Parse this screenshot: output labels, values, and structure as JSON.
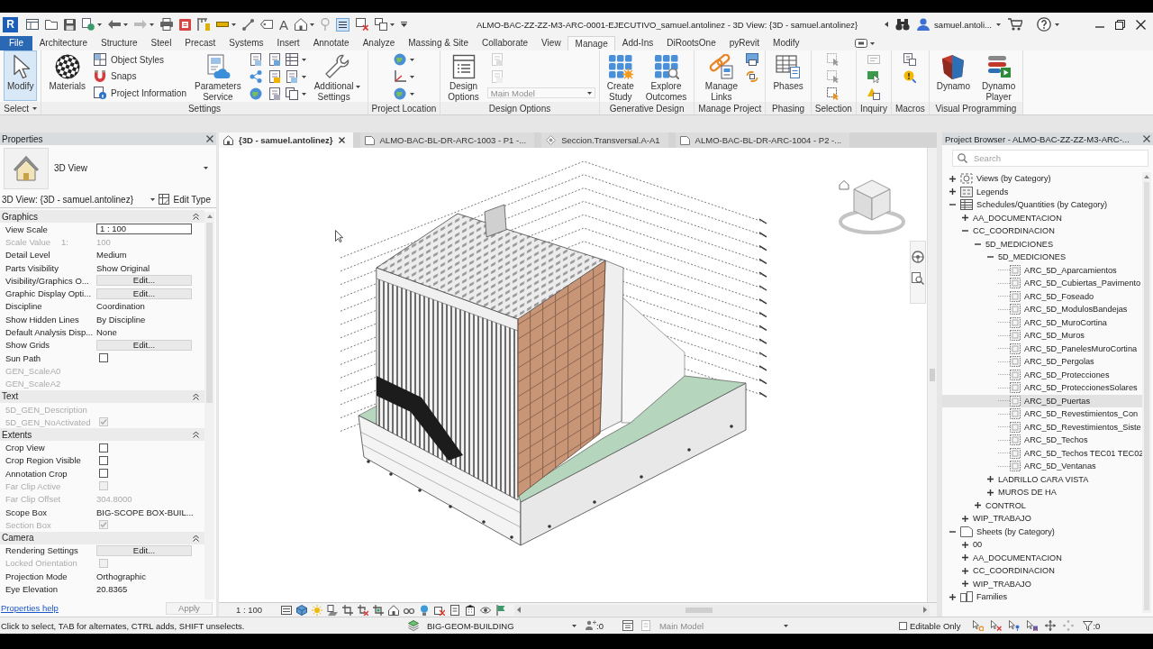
{
  "title_bar": {
    "logo": "R",
    "text_tool": "A",
    "title": "ALMO-BAC-ZZ-ZZ-M3-ARC-0001-EJECUTIVO_samuel.antolinez - 3D View: {3D - samuel.antolinez}",
    "user": "samuel.antoli..."
  },
  "menu_tabs": [
    {
      "label": "File",
      "kind": "file",
      "selected": false
    },
    {
      "label": "Architecture",
      "kind": "tab",
      "selected": false
    },
    {
      "label": "Structure",
      "kind": "tab",
      "selected": false
    },
    {
      "label": "Steel",
      "kind": "tab",
      "selected": false
    },
    {
      "label": "Precast",
      "kind": "tab",
      "selected": false
    },
    {
      "label": "Systems",
      "kind": "tab",
      "selected": false
    },
    {
      "label": "Insert",
      "kind": "tab",
      "selected": false
    },
    {
      "label": "Annotate",
      "kind": "tab",
      "selected": false
    },
    {
      "label": "Analyze",
      "kind": "tab",
      "selected": false
    },
    {
      "label": "Massing & Site",
      "kind": "tab",
      "selected": false
    },
    {
      "label": "Collaborate",
      "kind": "tab",
      "selected": false
    },
    {
      "label": "View",
      "kind": "tab",
      "selected": false
    },
    {
      "label": "Manage",
      "kind": "tab",
      "selected": true
    },
    {
      "label": "Add-Ins",
      "kind": "tab",
      "selected": false
    },
    {
      "label": "DiRootsOne",
      "kind": "tab",
      "selected": false
    },
    {
      "label": "pyRevit",
      "kind": "tab",
      "selected": false
    },
    {
      "label": "Modify",
      "kind": "tab",
      "selected": false
    }
  ],
  "ribbon": {
    "panels": [
      {
        "title": "Select",
        "menu": true,
        "tools": [
          {
            "kind": "large",
            "label": "Modify",
            "active": true,
            "menu": false
          }
        ]
      },
      {
        "title": "Settings",
        "menu": false,
        "tools": [
          {
            "kind": "large",
            "label": "Materials",
            "active": false,
            "menu": false
          },
          {
            "kind": "small_stack",
            "labels": [
              "Object Styles",
              "Snaps",
              "Project Information"
            ]
          },
          {
            "kind": "large",
            "label": "Parameters Service",
            "active": false,
            "menu": false
          },
          {
            "kind": "icon_grid"
          },
          {
            "kind": "icon_menus"
          },
          {
            "kind": "large",
            "label": "Additional Settings",
            "active": false,
            "menu": true
          }
        ]
      },
      {
        "title": "Project Location",
        "menu": false,
        "tools": [
          {
            "kind": "icon_menus"
          }
        ]
      },
      {
        "title": "Design Options",
        "menu": false,
        "tools": [
          {
            "kind": "large",
            "label": "Design Options",
            "active": false,
            "menu": false
          },
          {
            "kind": "option_set",
            "value": "Main Model",
            "disabled": true
          }
        ]
      },
      {
        "title": "Generative Design",
        "menu": false,
        "tools": [
          {
            "kind": "large",
            "label": "Create Study",
            "active": false,
            "menu": false
          },
          {
            "kind": "large",
            "label": "Explore Outcomes",
            "active": false,
            "menu": false
          }
        ]
      },
      {
        "title": "Manage Project",
        "menu": false,
        "tools": [
          {
            "kind": "large",
            "label": "Manage Links",
            "active": false,
            "menu": false
          },
          {
            "kind": "icon_column"
          }
        ]
      },
      {
        "title": "Phasing",
        "menu": false,
        "tools": [
          {
            "kind": "large",
            "label": "Phases",
            "active": false,
            "menu": false
          }
        ]
      },
      {
        "title": "Selection",
        "menu": false,
        "tools": [
          {
            "kind": "icon_column"
          }
        ]
      },
      {
        "title": "Inquiry",
        "menu": false,
        "tools": [
          {
            "kind": "icon_column"
          }
        ]
      },
      {
        "title": "Macros",
        "menu": false,
        "tools": [
          {
            "kind": "icon_column"
          }
        ]
      },
      {
        "title": "Visual Programming",
        "menu": false,
        "tools": [
          {
            "kind": "large",
            "label": "Dynamo",
            "active": false,
            "menu": false
          },
          {
            "kind": "large",
            "label": "Dynamo Player",
            "active": false,
            "menu": false
          }
        ]
      }
    ]
  },
  "properties": {
    "title": "Properties",
    "type_name": "3D View",
    "instance": "3D View: {3D - samuel.antolinez}",
    "edit_type": "Edit Type",
    "groups": [
      {
        "title": "Graphics",
        "expanded": true,
        "rows": [
          {
            "name": "View Scale",
            "kind": "field",
            "value": "1 : 100",
            "disabled": false
          },
          {
            "name": "Scale Value",
            "unit": "1:",
            "kind": "text",
            "value": "100",
            "disabled": true
          },
          {
            "name": "Detail Level",
            "kind": "text",
            "value": "Medium",
            "disabled": false
          },
          {
            "name": "Parts Visibility",
            "kind": "text",
            "value": "Show Original",
            "disabled": false
          },
          {
            "name": "Visibility/Graphics O...",
            "kind": "button",
            "value": "Edit...",
            "disabled": false
          },
          {
            "name": "Graphic Display Opti...",
            "kind": "button",
            "value": "Edit...",
            "disabled": false
          },
          {
            "name": "Discipline",
            "kind": "text",
            "value": "Coordination",
            "disabled": false
          },
          {
            "name": "Show Hidden Lines",
            "kind": "text",
            "value": "By Discipline",
            "disabled": false
          },
          {
            "name": "Default Analysis Disp...",
            "kind": "text",
            "value": "None",
            "disabled": false
          },
          {
            "name": "Show Grids",
            "kind": "button",
            "value": "Edit...",
            "disabled": false
          },
          {
            "name": "Sun Path",
            "kind": "checkbox",
            "checked": false,
            "disabled": false
          },
          {
            "name": "GEN_ScaleA0",
            "kind": "text",
            "disabled": true
          },
          {
            "name": "GEN_ScaleA2",
            "kind": "text",
            "disabled": true
          }
        ]
      },
      {
        "title": "Text",
        "expanded": true,
        "rows": [
          {
            "name": "5D_GEN_Description",
            "kind": "text",
            "disabled": true
          },
          {
            "name": "5D_GEN_NoActivated",
            "kind": "checkbox",
            "checked": true,
            "disabled": true
          }
        ]
      },
      {
        "title": "Extents",
        "expanded": true,
        "rows": [
          {
            "name": "Crop View",
            "kind": "checkbox",
            "checked": false,
            "disabled": false
          },
          {
            "name": "Crop Region Visible",
            "kind": "checkbox",
            "checked": false,
            "disabled": false
          },
          {
            "name": "Annotation Crop",
            "kind": "checkbox",
            "checked": false,
            "disabled": false
          },
          {
            "name": "Far Clip Active",
            "kind": "checkbox",
            "checked": false,
            "disabled": true
          },
          {
            "name": "Far Clip Offset",
            "kind": "text",
            "value": "304.8000",
            "disabled": true
          },
          {
            "name": "Scope Box",
            "kind": "text",
            "value": "BIG-SCOPE BOX-BUIL...",
            "disabled": false
          },
          {
            "name": "Section Box",
            "kind": "checkbox",
            "checked": true,
            "disabled": true
          }
        ]
      },
      {
        "title": "Camera",
        "expanded": true,
        "rows": [
          {
            "name": "Rendering Settings",
            "kind": "button",
            "value": "Edit...",
            "disabled": false
          },
          {
            "name": "Locked Orientation",
            "kind": "checkbox",
            "checked": false,
            "disabled": true
          },
          {
            "name": "Projection Mode",
            "kind": "text",
            "value": "Orthographic",
            "disabled": false
          },
          {
            "name": "Eye Elevation",
            "kind": "text",
            "value": "20.8365",
            "disabled": false
          }
        ]
      }
    ],
    "help_link": "Properties help",
    "apply": {
      "label": "Apply",
      "disabled": true
    }
  },
  "view_tabs": [
    {
      "label": "{3D - samuel.antolinez}",
      "kind": "model",
      "selected": true
    },
    {
      "label": "ALMO-BAC-BL-DR-ARC-1003 - P1 -...",
      "kind": "sheet",
      "selected": false
    },
    {
      "label": "Seccion.Transversal.A-A1",
      "kind": "section",
      "selected": false
    },
    {
      "label": "ALMO-BAC-BL-DR-ARC-1004 - P2 -...",
      "kind": "sheet",
      "selected": false
    }
  ],
  "view_control_bar": {
    "scale": "1 : 100"
  },
  "project_browser": {
    "title": "Project Browser - ALMO-BAC-ZZ-ZZ-M3-ARC-...",
    "search": {
      "placeholder": "Search"
    },
    "tree": [
      {
        "kind": "category",
        "label": "Views (by Category)",
        "expanded": false,
        "selected": false
      },
      {
        "kind": "category",
        "label": "Legends",
        "expanded": false,
        "selected": false
      },
      {
        "kind": "category",
        "label": "Schedules/Quantities (by Category)",
        "expanded": true,
        "selected": false,
        "children": [
          {
            "kind": "folder",
            "label": "AA_DOCUMENTACION",
            "expanded": false,
            "selected": false
          },
          {
            "kind": "folder",
            "label": "CC_COORDINACION",
            "expanded": true,
            "selected": false,
            "children": [
              {
                "kind": "folder",
                "label": "5D_MEDICIONES",
                "expanded": true,
                "selected": false,
                "children": [
                  {
                    "kind": "folder",
                    "label": "5D_MEDICIONES",
                    "expanded": true,
                    "selected": false,
                    "children": [
                      {
                        "kind": "schedule",
                        "label": "ARC_5D_Aparcamientos",
                        "selected": false
                      },
                      {
                        "kind": "schedule",
                        "label": "ARC_5D_Cubiertas_Pavimento",
                        "selected": false
                      },
                      {
                        "kind": "schedule",
                        "label": "ARC_5D_Foseado",
                        "selected": false
                      },
                      {
                        "kind": "schedule",
                        "label": "ARC_5D_ModulosBandejas",
                        "selected": false
                      },
                      {
                        "kind": "schedule",
                        "label": "ARC_5D_MuroCortina",
                        "selected": false
                      },
                      {
                        "kind": "schedule",
                        "label": "ARC_5D_Muros",
                        "selected": false
                      },
                      {
                        "kind": "schedule",
                        "label": "ARC_5D_PanelesMuroCortina",
                        "selected": false
                      },
                      {
                        "kind": "schedule",
                        "label": "ARC_5D_Pergolas",
                        "selected": false
                      },
                      {
                        "kind": "schedule",
                        "label": "ARC_5D_Protecciones",
                        "selected": false
                      },
                      {
                        "kind": "schedule",
                        "label": "ARC_5D_ProteccionesSolares",
                        "selected": false
                      },
                      {
                        "kind": "schedule",
                        "label": "ARC_5D_Puertas",
                        "selected": true
                      },
                      {
                        "kind": "schedule",
                        "label": "ARC_5D_Revestimientos_Con",
                        "selected": false
                      },
                      {
                        "kind": "schedule",
                        "label": "ARC_5D_Revestimientos_Siste",
                        "selected": false
                      },
                      {
                        "kind": "schedule",
                        "label": "ARC_5D_Techos",
                        "selected": false
                      },
                      {
                        "kind": "schedule",
                        "label": "ARC_5D_Techos TEC01 TEC02",
                        "selected": false
                      },
                      {
                        "kind": "schedule",
                        "label": "ARC_5D_Ventanas",
                        "selected": false
                      }
                    ]
                  },
                  {
                    "kind": "folder",
                    "label": "LADRILLO CARA VISTA",
                    "expanded": false,
                    "selected": false
                  },
                  {
                    "kind": "folder",
                    "label": "MUROS DE HA",
                    "expanded": false,
                    "selected": false
                  }
                ]
              },
              {
                "kind": "folder",
                "label": "CONTROL",
                "expanded": false,
                "selected": false
              }
            ]
          },
          {
            "kind": "folder",
            "label": "WIP_TRABAJO",
            "expanded": false,
            "selected": false
          }
        ]
      },
      {
        "kind": "category",
        "label": "Sheets (by Category)",
        "expanded": true,
        "selected": false,
        "children": [
          {
            "kind": "folder",
            "label": "00",
            "expanded": false,
            "selected": false
          },
          {
            "kind": "folder",
            "label": "AA_DOCUMENTACION",
            "expanded": false,
            "selected": false
          },
          {
            "kind": "folder",
            "label": "CC_COORDINACION",
            "expanded": false,
            "selected": false
          },
          {
            "kind": "folder",
            "label": "WIP_TRABAJO",
            "expanded": false,
            "selected": false
          }
        ]
      },
      {
        "kind": "category",
        "label": "Families",
        "expanded": false,
        "selected": false
      }
    ]
  },
  "status_bar": {
    "hint": "Click to select, TAB for alternates, CTRL adds, SHIFT unselects.",
    "workset": "BIG-GEOM-BUILDING",
    "edit_requests": ":0",
    "design_option": {
      "value": "Main Model",
      "disabled": true
    },
    "editable_only": {
      "label": "Editable Only",
      "checked": false
    },
    "filter_count": ":0"
  }
}
